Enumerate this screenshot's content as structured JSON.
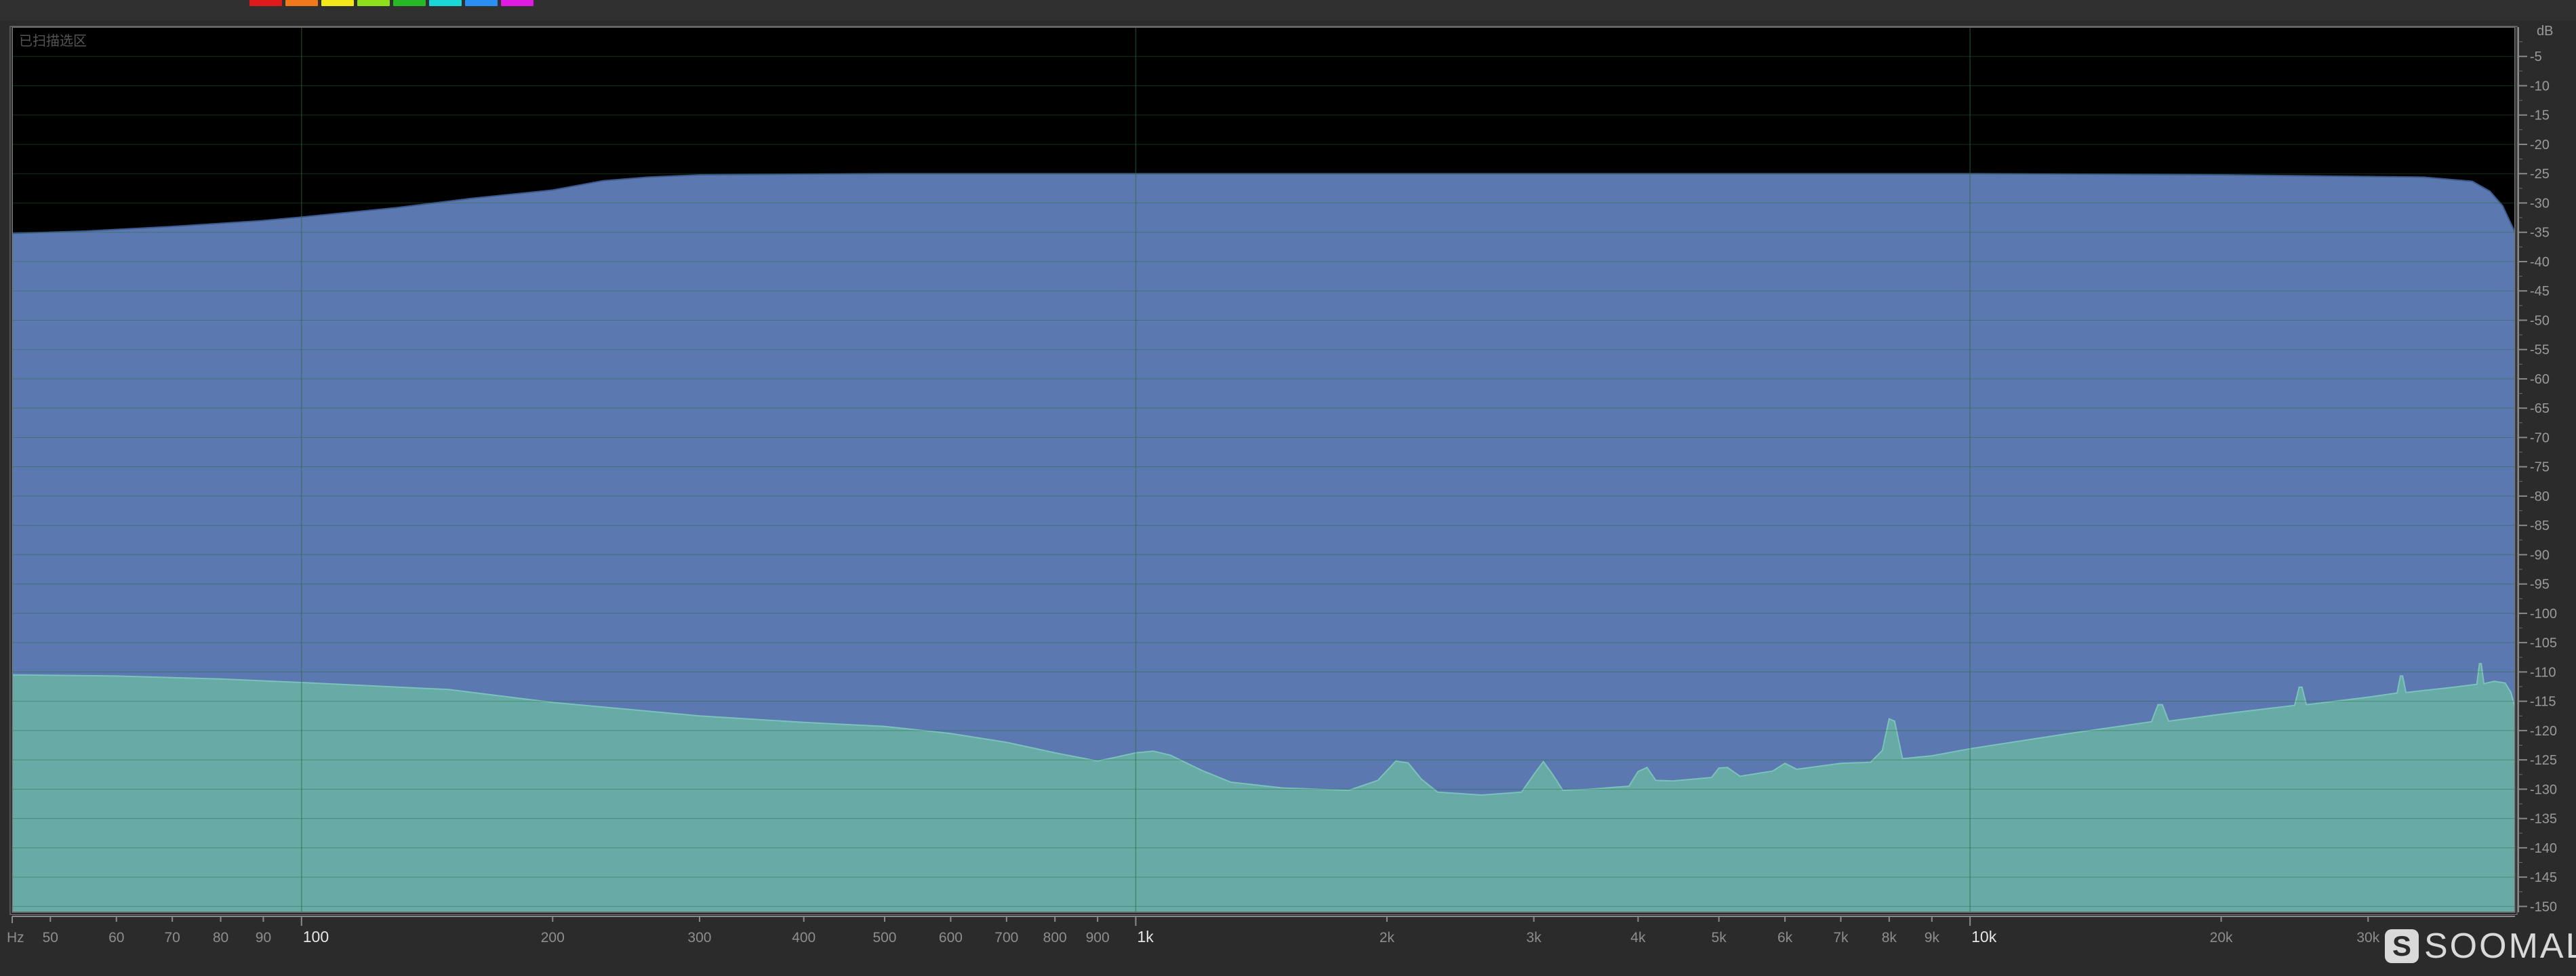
{
  "toolbar": {
    "channel_colors": [
      "#e01a1a",
      "#f07a1a",
      "#f2e81a",
      "#8ee01a",
      "#26b826",
      "#1ad8d8",
      "#2a8ef2",
      "#e01ae0"
    ]
  },
  "overlay": {
    "selection_label": "已扫描选区"
  },
  "watermark": {
    "logo_glyph": "S",
    "logo_text": "SOOMAL"
  },
  "chart_data": {
    "type": "area",
    "title": "",
    "x_unit_label": "Hz",
    "y_unit_label": "dB",
    "x_scale": "log",
    "xlim": [
      45,
      45000
    ],
    "ylim": [
      -151,
      0
    ],
    "grid": true,
    "x_ticks": [
      {
        "value": 50,
        "label": "50",
        "major": false
      },
      {
        "value": 60,
        "label": "60",
        "major": false
      },
      {
        "value": 70,
        "label": "70",
        "major": false
      },
      {
        "value": 80,
        "label": "80",
        "major": false
      },
      {
        "value": 90,
        "label": "90",
        "major": false
      },
      {
        "value": 100,
        "label": "100",
        "major": true
      },
      {
        "value": 200,
        "label": "200",
        "major": false
      },
      {
        "value": 300,
        "label": "300",
        "major": false
      },
      {
        "value": 400,
        "label": "400",
        "major": false
      },
      {
        "value": 500,
        "label": "500",
        "major": false
      },
      {
        "value": 600,
        "label": "600",
        "major": false
      },
      {
        "value": 700,
        "label": "700",
        "major": false
      },
      {
        "value": 800,
        "label": "800",
        "major": false
      },
      {
        "value": 900,
        "label": "900",
        "major": false
      },
      {
        "value": 1000,
        "label": "1k",
        "major": true
      },
      {
        "value": 2000,
        "label": "2k",
        "major": false
      },
      {
        "value": 3000,
        "label": "3k",
        "major": false
      },
      {
        "value": 4000,
        "label": "4k",
        "major": false
      },
      {
        "value": 5000,
        "label": "5k",
        "major": false
      },
      {
        "value": 6000,
        "label": "6k",
        "major": false
      },
      {
        "value": 7000,
        "label": "7k",
        "major": false
      },
      {
        "value": 8000,
        "label": "8k",
        "major": false
      },
      {
        "value": 9000,
        "label": "9k",
        "major": false
      },
      {
        "value": 10000,
        "label": "10k",
        "major": true
      },
      {
        "value": 20000,
        "label": "20k",
        "major": false
      },
      {
        "value": 30000,
        "label": "30k",
        "major": false
      }
    ],
    "y_ticks": [
      -5,
      -10,
      -15,
      -20,
      -25,
      -30,
      -35,
      -40,
      -45,
      -50,
      -55,
      -60,
      -65,
      -70,
      -75,
      -80,
      -85,
      -90,
      -95,
      -100,
      -105,
      -110,
      -115,
      -120,
      -125,
      -130,
      -135,
      -140,
      -145,
      -150
    ],
    "series": [
      {
        "color": "#5b78b0",
        "points": [
          [
            45,
            -35.2
          ],
          [
            55,
            -34.8
          ],
          [
            70,
            -34
          ],
          [
            90,
            -33
          ],
          [
            100,
            -32.4
          ],
          [
            130,
            -30.8
          ],
          [
            160,
            -29.2
          ],
          [
            200,
            -27.8
          ],
          [
            230,
            -26.2
          ],
          [
            260,
            -25.6
          ],
          [
            300,
            -25.2
          ],
          [
            500,
            -25
          ],
          [
            1000,
            -25
          ],
          [
            5000,
            -25
          ],
          [
            10000,
            -25
          ],
          [
            20000,
            -25.2
          ],
          [
            35000,
            -25.6
          ],
          [
            40000,
            -26.3
          ],
          [
            42000,
            -28
          ],
          [
            43500,
            -30.5
          ],
          [
            45000,
            -35
          ]
        ]
      },
      {
        "color": "#68aaa6",
        "points": [
          [
            45,
            -110.5
          ],
          [
            60,
            -110.7
          ],
          [
            80,
            -111.2
          ],
          [
            100,
            -111.8
          ],
          [
            150,
            -113
          ],
          [
            200,
            -115.2
          ],
          [
            300,
            -117.5
          ],
          [
            400,
            -118.6
          ],
          [
            500,
            -119.3
          ],
          [
            600,
            -120.5
          ],
          [
            700,
            -122
          ],
          [
            800,
            -123.8
          ],
          [
            900,
            -125.2
          ],
          [
            950,
            -124.5
          ],
          [
            1000,
            -123.8
          ],
          [
            1050,
            -123.5
          ],
          [
            1100,
            -124.2
          ],
          [
            1200,
            -126.8
          ],
          [
            1300,
            -128.8
          ],
          [
            1500,
            -129.8
          ],
          [
            1800,
            -130.2
          ],
          [
            1950,
            -128.5
          ],
          [
            2050,
            -125.2
          ],
          [
            2120,
            -125.5
          ],
          [
            2200,
            -128.3
          ],
          [
            2300,
            -130.5
          ],
          [
            2600,
            -131
          ],
          [
            2900,
            -130.5
          ],
          [
            3000,
            -127.5
          ],
          [
            3080,
            -125.3
          ],
          [
            3160,
            -127.5
          ],
          [
            3250,
            -130.2
          ],
          [
            3500,
            -130
          ],
          [
            3900,
            -129.5
          ],
          [
            4000,
            -127
          ],
          [
            4100,
            -126.3
          ],
          [
            4200,
            -128.5
          ],
          [
            4400,
            -128.6
          ],
          [
            4900,
            -128
          ],
          [
            5000,
            -126.4
          ],
          [
            5120,
            -126.3
          ],
          [
            5300,
            -127.8
          ],
          [
            5800,
            -126.9
          ],
          [
            6000,
            -125.6
          ],
          [
            6200,
            -126.6
          ],
          [
            7000,
            -125.6
          ],
          [
            7600,
            -125.4
          ],
          [
            7850,
            -123.4
          ],
          [
            8000,
            -118
          ],
          [
            8120,
            -118.4
          ],
          [
            8300,
            -124.8
          ],
          [
            9000,
            -124.3
          ],
          [
            10000,
            -123.1
          ],
          [
            13000,
            -120.6
          ],
          [
            16500,
            -118.5
          ],
          [
            16800,
            -115.6
          ],
          [
            17000,
            -115.6
          ],
          [
            17300,
            -118.4
          ],
          [
            20000,
            -117.2
          ],
          [
            24500,
            -115.7
          ],
          [
            24800,
            -112.6
          ],
          [
            25000,
            -112.6
          ],
          [
            25300,
            -115.6
          ],
          [
            30000,
            -114.3
          ],
          [
            32500,
            -113.6
          ],
          [
            32800,
            -110.7
          ],
          [
            33000,
            -110.7
          ],
          [
            33300,
            -113.5
          ],
          [
            38000,
            -112.6
          ],
          [
            40500,
            -112.1
          ],
          [
            40800,
            -108.6
          ],
          [
            41000,
            -108.6
          ],
          [
            41300,
            -112
          ],
          [
            42500,
            -111.6
          ],
          [
            43800,
            -111.9
          ],
          [
            44500,
            -113.5
          ],
          [
            45000,
            -116
          ]
        ]
      }
    ]
  }
}
